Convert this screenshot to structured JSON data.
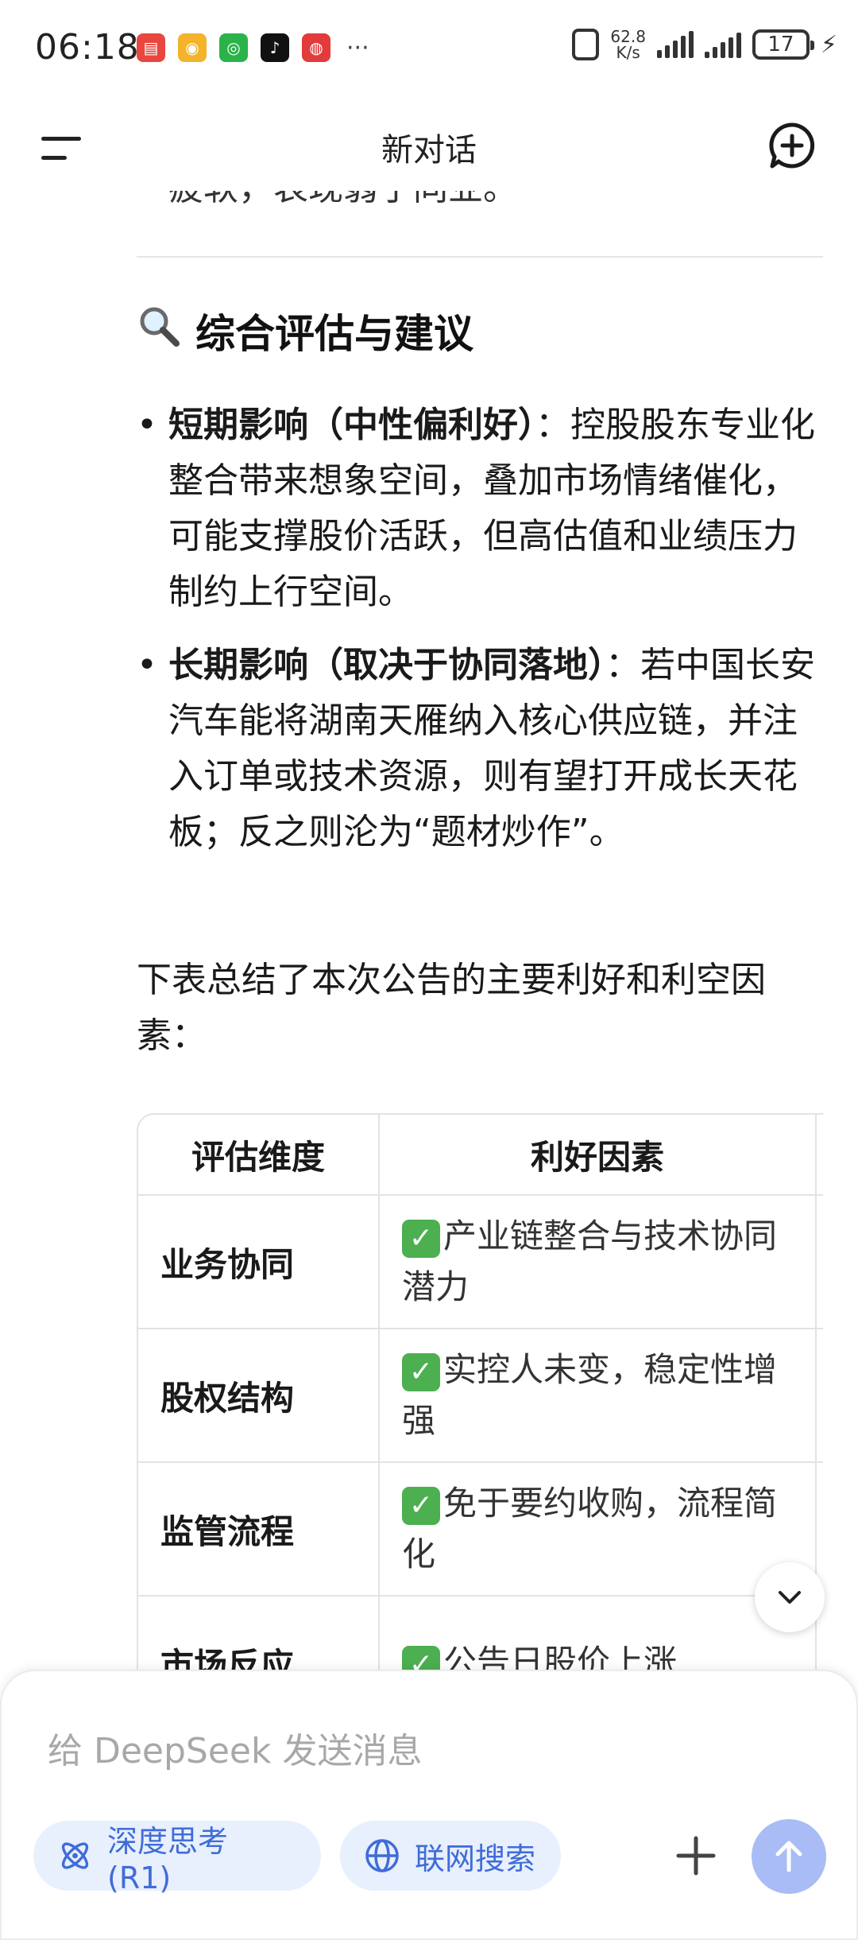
{
  "status_bar": {
    "time": "06:18",
    "net_speed_value": "62.8",
    "net_speed_unit": "K/s",
    "battery": "17",
    "more": "···"
  },
  "header": {
    "title": "新对话"
  },
  "chat": {
    "partial_line": "疲软，表现弱于同业。",
    "section_title": "综合评估与建议",
    "bullets": [
      {
        "bold": "短期影响（中性偏利好）",
        "text": "：控股股东专业化整合带来想象空间，叠加市场情绪催化，可能支撑股价活跃，但高估值和业绩压力制约上行空间。"
      },
      {
        "bold": "长期影响（取决于协同落地）",
        "text": "：若中国长安汽车能将湖南天雁纳入核心供应链，并注入订单或技术资源，则有望打开成长天花板；反之则沦为“题材炒作”。"
      }
    ],
    "summary": "下表总结了本次公告的主要利好和利空因素：",
    "table": {
      "headers": [
        "评估维度",
        "利好因素"
      ],
      "rows": [
        {
          "dim": "业务协同",
          "good": "产业链整合与技术协同潜力"
        },
        {
          "dim": "股权结构",
          "good": "实控人未变，稳定性增强"
        },
        {
          "dim": "监管流程",
          "good": "免于要约收购，流程简化"
        },
        {
          "dim": "市场反应",
          "good": "公告日股价上涨"
        }
      ]
    }
  },
  "composer": {
    "placeholder": "给 DeepSeek 发送消息",
    "deep_think_label": "深度思考 (R1)",
    "web_search_label": "联网搜索"
  },
  "colors": {
    "accent": "#3f6cd8",
    "chip_bg": "#e8effd",
    "send_bg": "#a9bcf5",
    "check": "#4caf50"
  }
}
